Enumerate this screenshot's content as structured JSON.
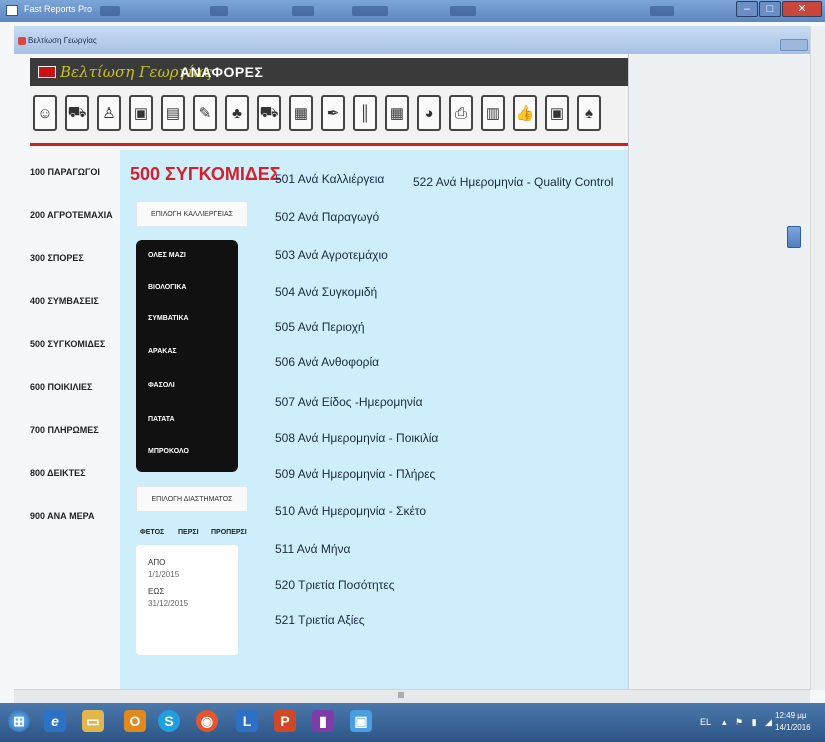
{
  "outer_window": {
    "title": "Fast Reports Pro"
  },
  "inner_window": {
    "title": "Βελτίωση Γεωργίας"
  },
  "app": {
    "brand": "Βελτίωση Γεωργίας",
    "title": "ΑΝΑΦΟΡΕΣ",
    "accent_color": "#d71f2a",
    "panel_color": "#cdeefa"
  },
  "toolbar_icons": [
    "people-icon",
    "tractor-icon",
    "worker-icon",
    "monitor-icon",
    "document-icon",
    "edit-icon",
    "plant-icon",
    "truck-icon",
    "factory-icon",
    "pen-icon",
    "barcode-icon",
    "calculator-icon",
    "pie-chart-icon",
    "printer-icon",
    "clipboard-icon",
    "thumbs-up-icon",
    "form-icon",
    "tree-icon"
  ],
  "nav": [
    "100 ΠΑΡΑΓΩΓΟΙ",
    "200 ΑΓΡΟΤΕΜΑΧΙΑ",
    "300 ΣΠΟΡΕΣ",
    "400 ΣΥΜΒΑΣΕΙΣ",
    "500 ΣΥΓΚΟΜΙΔΕΣ",
    "600 ΠΟΙΚΙΛΙΕΣ",
    "700 ΠΛΗΡΩΜΕΣ",
    "800 ΔΕΙΚΤΕΣ",
    "900 ΑΝΑ ΜΕΡΑ"
  ],
  "section": {
    "title": "500 ΣΥΓΚΟΜΙΔΕΣ"
  },
  "filters": {
    "crop_button": "ΕΠΙΛΟΓΗ ΚΑΛΛΙΕΡΓΕΙΑΣ",
    "crop_options": [
      "ΟΛΕΣ ΜΑΖΙ",
      "ΒΙΟΛΟΓΙΚΑ",
      "ΣΥΜΒΑΤΙΚΑ",
      "ΑΡΑΚΑΣ",
      "ΦΑΣΟΛΙ",
      "ΠΑΤΑΤΑ",
      "ΜΠΡΟΚΟΛΟ"
    ],
    "period_button": "ΕΠΙΛΟΓΗ ΔΙΑΣΤΗΜΑΤΟΣ",
    "period_options": [
      "ΦΕΤΟΣ",
      "ΠΕΡΣΙ",
      "ΠΡΟΠΕΡΣΙ"
    ],
    "from_label": "ΑΠΟ",
    "from_value": "1/1/2015",
    "to_label": "ΕΩΣ",
    "to_value": "31/12/2015"
  },
  "reports": [
    "501 Ανά Καλλιέργεια",
    "502 Ανά Παραγωγό",
    "503 Ανά Αγροτεμάχιο",
    "504 Ανά Συγκομιδή",
    "505 Ανά Περιοχή",
    "506 Ανά Ανθοφορία",
    "507 Ανά Είδος -Ημερομηνία",
    "508 Ανά Ημερομηνία - Ποικιλία",
    "509 Ανά Ημερομηνία - Πλήρες",
    "510 Ανά Ημερομηνία - Σκέτο",
    "511 Ανά Μήνα",
    "520 Τριετία Ποσότητες",
    "521 Τριετία Αξίες"
  ],
  "report_qc": "522 Ανά Ημερομηνία - Quality Control",
  "taskbar": {
    "icons": [
      "windows-start-icon",
      "internet-explorer-icon",
      "file-explorer-icon",
      "outlook-icon",
      "skype-icon",
      "firefox-icon",
      "lync-icon",
      "powerpoint-icon",
      "app-icon",
      "monitor-app-icon"
    ],
    "tray": "EL",
    "time": "12:49 μμ",
    "date": "14/1/2016"
  }
}
